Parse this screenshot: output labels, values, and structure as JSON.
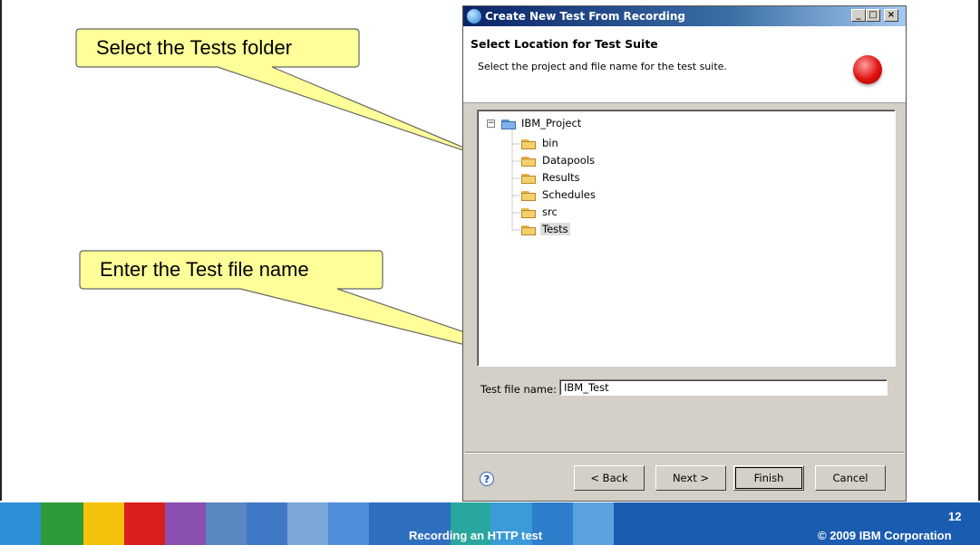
{
  "callouts": {
    "select_folder": "Select the Tests folder",
    "enter_name": "Enter the Test file name"
  },
  "dialog": {
    "title": "Create New Test From Recording",
    "heading": "Select Location for Test Suite",
    "description": "Select the project and file name for the test suite.",
    "tree": {
      "root": "IBM_Project",
      "items": [
        {
          "label": "bin",
          "selected": false
        },
        {
          "label": "Datapools",
          "selected": false
        },
        {
          "label": "Results",
          "selected": false
        },
        {
          "label": "Schedules",
          "selected": false
        },
        {
          "label": "src",
          "selected": false
        },
        {
          "label": "Tests",
          "selected": true
        }
      ]
    },
    "file_name_label": "Test file name:",
    "file_name_value": "IBM_Test",
    "buttons": {
      "back": "< Back",
      "next": "Next >",
      "finish": "Finish",
      "cancel": "Cancel"
    },
    "help_symbol": "?"
  },
  "footer": {
    "title": "Recording an HTTP test",
    "page_number": "12",
    "copyright": "© 2009 IBM Corporation"
  },
  "colors": {
    "callout_fill": "#ffff99",
    "title_bar": "#0a246a",
    "footer_blue": "#1a5cb0"
  },
  "icons": [
    "app-icon",
    "minimize-icon",
    "maximize-icon",
    "close-icon",
    "wizard-icon",
    "collapse-icon",
    "project-folder-icon",
    "folder-icon",
    "help-icon"
  ]
}
